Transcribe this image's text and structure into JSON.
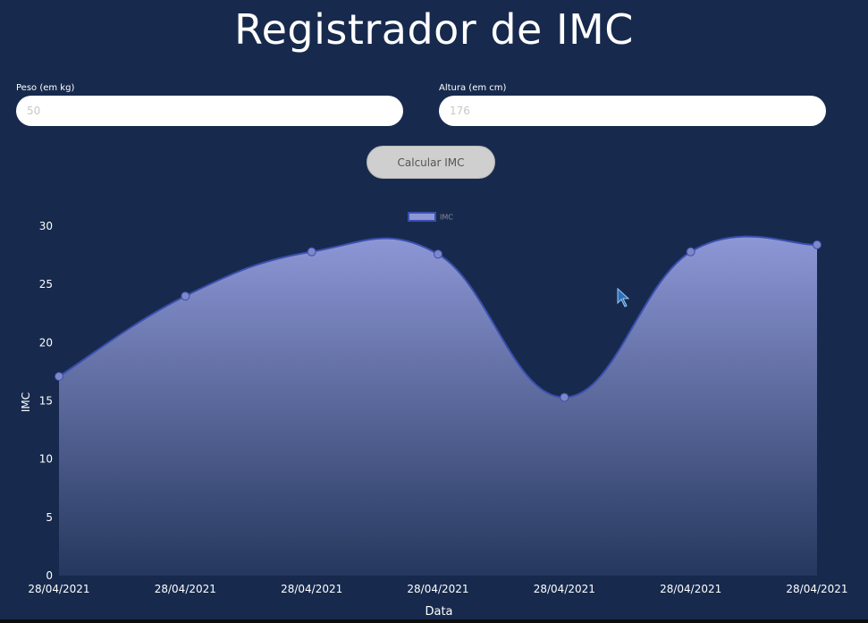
{
  "page": {
    "title": "Registrador de IMC"
  },
  "form": {
    "peso_label": "Peso (em kg)",
    "peso_placeholder": "50",
    "altura_label": "Altura (em cm)",
    "altura_placeholder": "176",
    "calc_button": "Calcular IMC"
  },
  "colors": {
    "background": "#172a4d",
    "line": "#3b4fb0",
    "fill_top": "#8d97d6",
    "point": "#7e88c8"
  },
  "chart_data": {
    "type": "area",
    "x": [
      "28/04/2021",
      "28/04/2021",
      "28/04/2021",
      "28/04/2021",
      "28/04/2021",
      "28/04/2021",
      "28/04/2021"
    ],
    "series": [
      {
        "name": "IMC",
        "values": [
          17.1,
          24.0,
          27.8,
          27.6,
          15.3,
          27.8,
          28.4
        ]
      }
    ],
    "xlabel": "Data",
    "ylabel": "IMC",
    "ylim": [
      0,
      30
    ],
    "yticks": [
      0,
      5,
      10,
      15,
      20,
      25,
      30
    ],
    "grid": false,
    "legend_placement": "top-center"
  }
}
